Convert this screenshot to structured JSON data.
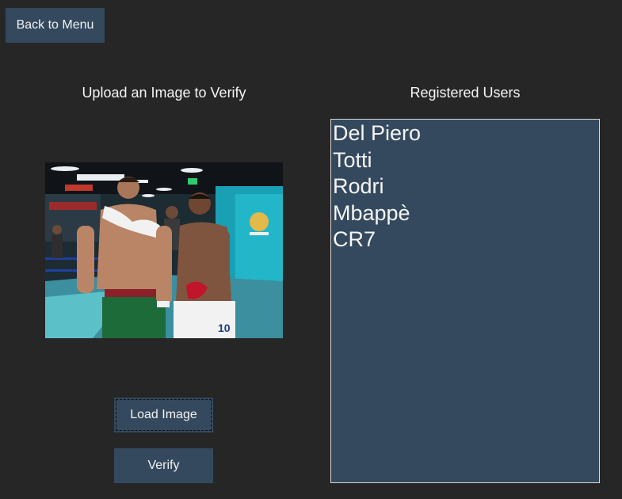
{
  "toolbar": {
    "back_label": "Back to Menu"
  },
  "upload": {
    "heading": "Upload an Image to Verify",
    "load_label": "Load Image",
    "verify_label": "Verify",
    "preview_alt": "Two footballers in a stadium tunnel",
    "shirt_number": "10"
  },
  "users": {
    "heading": "Registered Users",
    "items": [
      "Del Piero",
      "Totti",
      "Rodri",
      "Mbappè",
      "CR7"
    ]
  },
  "colors": {
    "background": "#262626",
    "panel": "#34495e",
    "text": "#f5f5f5"
  }
}
